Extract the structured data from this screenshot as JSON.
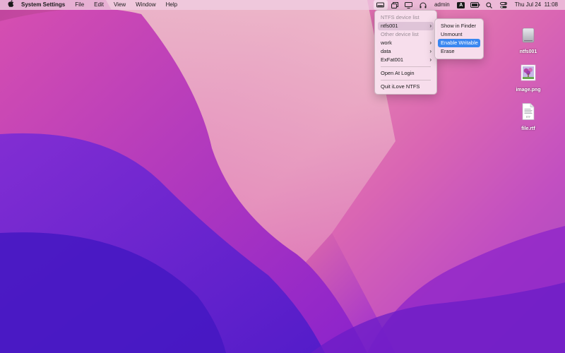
{
  "menubar": {
    "apple_icon": "apple-logo-icon",
    "app_name": "System Settings",
    "menus": [
      "File",
      "Edit",
      "View",
      "Window",
      "Help"
    ],
    "status": {
      "user": "admin",
      "input_source": "A",
      "clock": "Thu Jul 24  11:08"
    }
  },
  "ntfs_menu": {
    "items": [
      {
        "label": "NTFS device list",
        "state": "disabled"
      },
      {
        "label": "ntfs001",
        "state": "open",
        "submenu": true
      },
      {
        "label": "Other device list",
        "state": "disabled"
      },
      {
        "label": "work",
        "state": "normal",
        "submenu": true
      },
      {
        "label": "data",
        "state": "normal",
        "submenu": true
      },
      {
        "label": "ExFat001",
        "state": "normal",
        "submenu": true
      },
      {
        "label": "Open At Login",
        "state": "normal"
      },
      {
        "label": "Quit iLove NTFS",
        "state": "normal"
      }
    ],
    "submenu_arrow": "›"
  },
  "ntfs_submenu": {
    "items": [
      {
        "label": "Show in Finder"
      },
      {
        "label": "Unmount"
      },
      {
        "label": "Enable Writable",
        "highlighted": true
      },
      {
        "label": "Erase"
      }
    ]
  },
  "desktop_icons": [
    {
      "label": "ntfs001",
      "icon": "external-drive-icon"
    },
    {
      "label": "image.png",
      "icon": "image-file-icon"
    },
    {
      "label": "file.rtf",
      "icon": "rtf-document-icon"
    }
  ],
  "colors": {
    "highlight": "#3a87f0",
    "menu_bg": "#f8e2ee"
  }
}
